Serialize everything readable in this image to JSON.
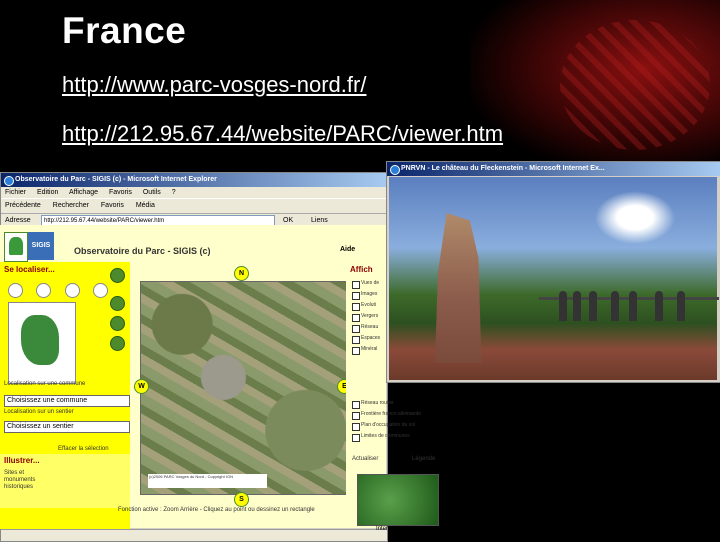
{
  "slide": {
    "title": "France",
    "links": [
      "http://www.parc-vosges-nord.fr/",
      "http://212.95.67.44/website/PARC/viewer.htm"
    ]
  },
  "window1": {
    "title": "Observatoire du Parc - SIGIS (c) - Microsoft Internet Explorer",
    "menu": [
      "Fichier",
      "Edition",
      "Affichage",
      "Favoris",
      "Outils",
      "?"
    ],
    "toolbar": [
      "Précédente",
      "Rechercher",
      "Favoris",
      "Média"
    ],
    "address_label": "Adresse",
    "address": "http://212.95.67.44/website/PARC/viewer.htm",
    "go_label": "OK",
    "links_label": "Liens",
    "site_title": "Observatoire du Parc - SIGIS (c)",
    "aide": "Aide",
    "logo_sigis": "SIGIS",
    "se_localiser": "Se localiser...",
    "localisation_commune_label": "Localisation sur une commune",
    "commune_select": "Choisissez une commune",
    "localisation_sentier_label": "Localisation sur un sentier",
    "sentier_select": "Choisissez un sentier",
    "effacer": "Effacer la sélection",
    "illustrer": "Illustrer...",
    "illustrer_items": [
      "Sites et",
      "monuments",
      "historiques"
    ],
    "map_copyright": "(c)2006 PARC Vosges du Nord - Copyright IGN",
    "compass": [
      "N",
      "W",
      "E",
      "S"
    ],
    "affichage_title": "Affich",
    "layers": [
      {
        "label": "Vues de",
        "checked": true
      },
      {
        "label": "Images",
        "checked": true
      },
      {
        "label": "Evoluti",
        "checked": true
      },
      {
        "label": "Vergers",
        "checked": false
      },
      {
        "label": "Réseau",
        "checked": true
      },
      {
        "label": "Espaces",
        "checked": false
      },
      {
        "label": "Minéral",
        "checked": false
      }
    ],
    "layers2": [
      {
        "label": "Réseau routier",
        "checked": false
      },
      {
        "label": "Frontière franco-allemande",
        "checked": false
      },
      {
        "label": "Plan d'occupation du sol",
        "checked": false
      },
      {
        "label": "Limites de communes",
        "checked": false
      }
    ],
    "actualiser": "Actualiser",
    "legende": "Légende",
    "status": "Fonction active : Zoom Arrière - Cliquez au point ou dessinez un rectangle",
    "internet": "Internet"
  },
  "window2": {
    "title": "PNRVN - Le château du Fleckenstein - Microsoft Internet Ex..."
  }
}
